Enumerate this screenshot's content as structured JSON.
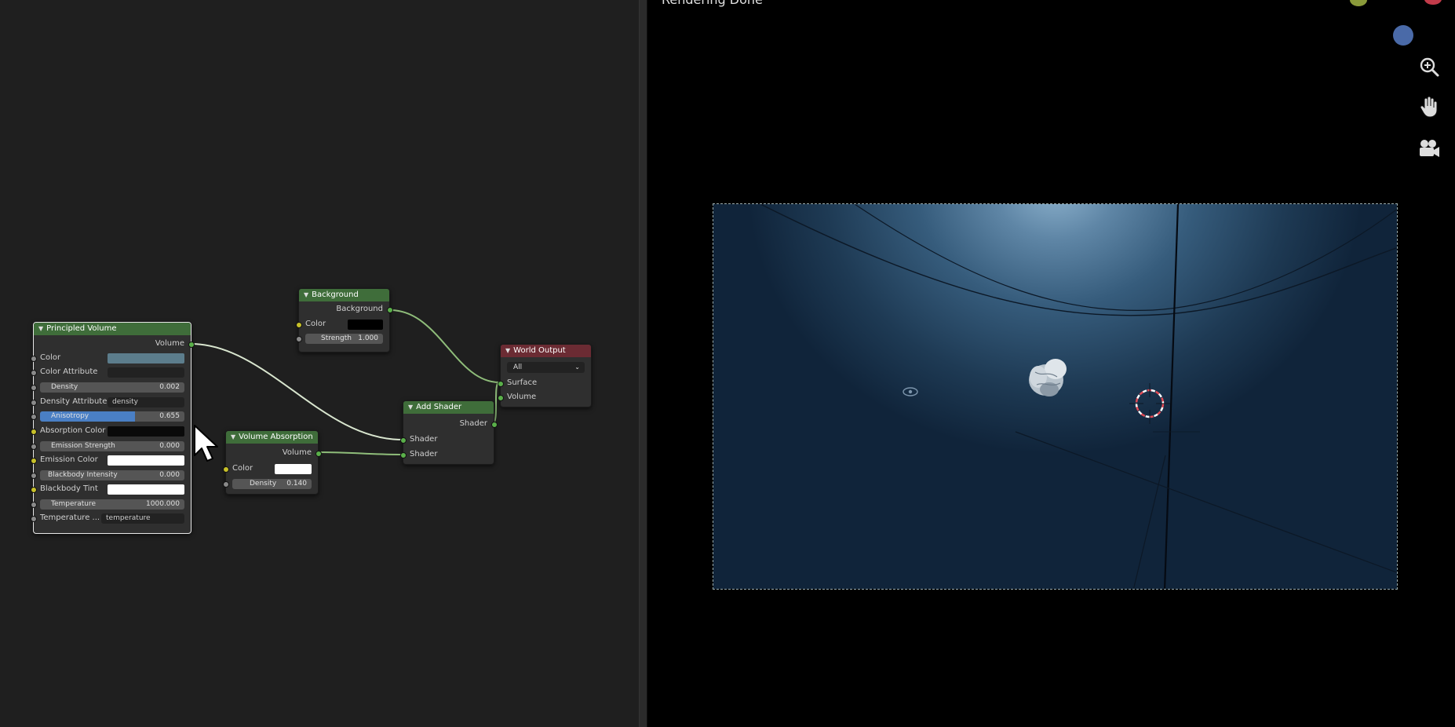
{
  "node_editor": {
    "principled_volume": {
      "title": "Principled Volume",
      "output": "Volume",
      "color_label": "Color",
      "color_value": "#5c7d8c",
      "color_attribute_label": "Color Attribute",
      "density_label": "Density",
      "density_value": "0.002",
      "density_attribute_label": "Density Attribute",
      "density_attribute_value": "density",
      "anisotropy_label": "Anisotropy",
      "anisotropy_value": "0.655",
      "anisotropy_fill": 0.655,
      "absorption_color_label": "Absorption Color",
      "absorption_color_value": "#0a0a0a",
      "emission_strength_label": "Emission Strength",
      "emission_strength_value": "0.000",
      "emission_color_label": "Emission Color",
      "emission_color_value": "#ffffff",
      "blackbody_intensity_label": "Blackbody Intensity",
      "blackbody_intensity_value": "0.000",
      "blackbody_tint_label": "Blackbody Tint",
      "blackbody_tint_value": "#ffffff",
      "temperature_label": "Temperature",
      "temperature_value": "1000.000",
      "temperature_attr_label": "Temperature ...",
      "temperature_attr_value": "temperature"
    },
    "background": {
      "title": "Background",
      "output": "Background",
      "color_label": "Color",
      "color_value": "#000000",
      "strength_label": "Strength",
      "strength_value": "1.000"
    },
    "volume_absorption": {
      "title": "Volume Absorption",
      "output": "Volume",
      "color_label": "Color",
      "color_value": "#ffffff",
      "density_label": "Density",
      "density_value": "0.140"
    },
    "add_shader": {
      "title": "Add Shader",
      "output": "Shader",
      "input1": "Shader",
      "input2": "Shader"
    },
    "world_output": {
      "title": "World Output",
      "target": "All",
      "input_surface": "Surface",
      "input_volume": "Volume"
    }
  },
  "viewport": {
    "title": "Rendering Done",
    "tools": [
      "zoom-icon",
      "hand-pan-icon",
      "camera-icon"
    ],
    "gizmo_colors": {
      "y_axis": "#8a9a3a",
      "x_axis": "#c23b4a",
      "z_axis": "#4a6aa8"
    }
  },
  "colors": {
    "node_header_green": "#3f6d3a",
    "node_header_red": "#6b2b33",
    "socket_green": "#5ab04a",
    "anisotropy_accent": "#4a7fc4"
  }
}
